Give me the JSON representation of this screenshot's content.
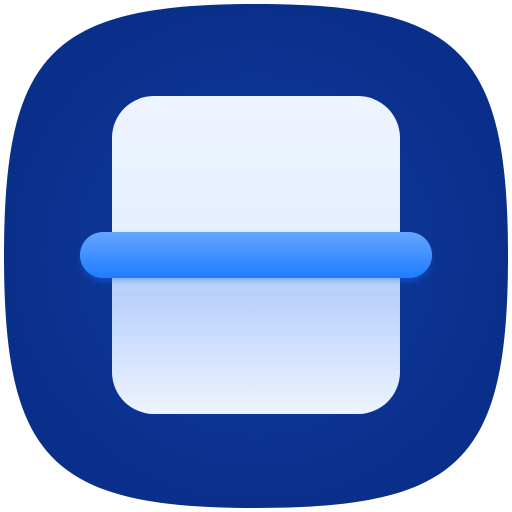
{
  "icon": {
    "name": "document-scanner-app-icon",
    "glyph": "scan-icon",
    "colors": {
      "background_outer": "#0a2f8a",
      "background_glow": "#103ea6",
      "page_top": "#eef4ff",
      "page_bottom": "#a9c6fb",
      "scan_bar": "#2f86ff",
      "scan_bar_highlight": "#64a6ff"
    }
  }
}
